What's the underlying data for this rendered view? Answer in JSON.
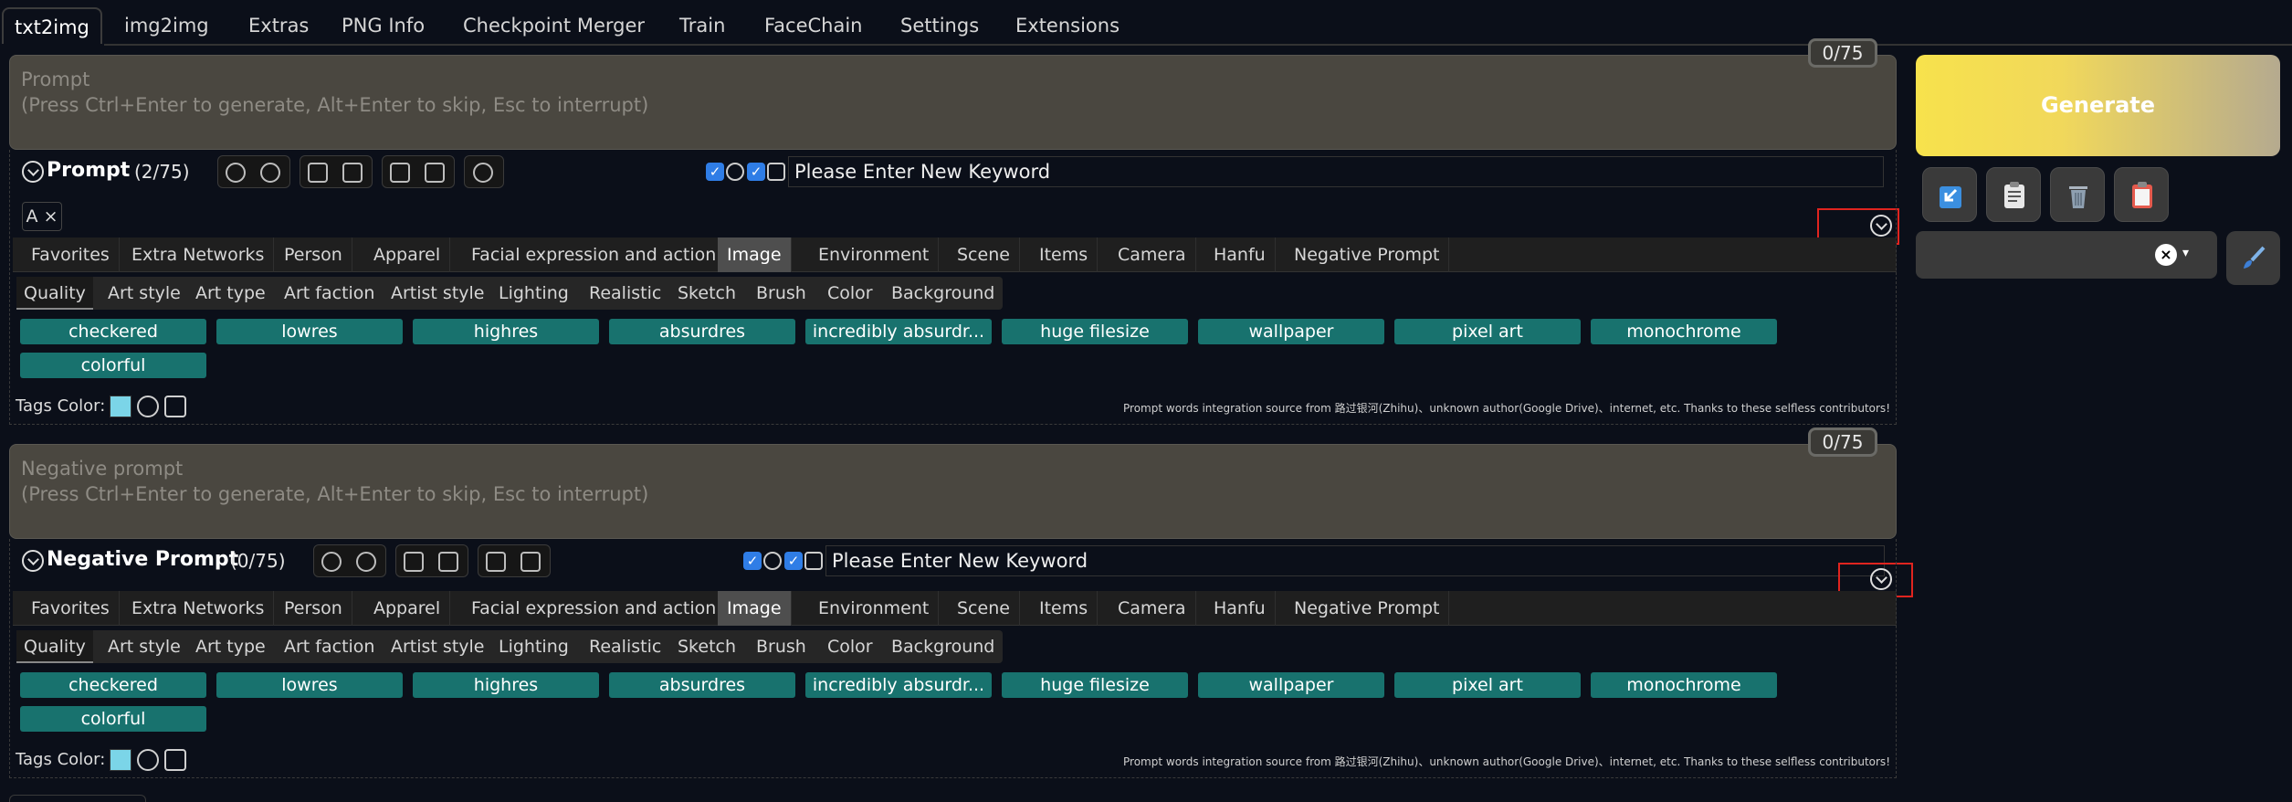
{
  "top_tabs": [
    "txt2img",
    "img2img",
    "Extras",
    "PNG Info",
    "Checkpoint Merger",
    "Train",
    "FaceChain",
    "Settings",
    "Extensions"
  ],
  "prompt": {
    "placeholder_line1": "Prompt",
    "placeholder_line2": "(Press Ctrl+Enter to generate, Alt+Enter to skip, Esc to interrupt)",
    "counter": "0/75"
  },
  "negative_prompt": {
    "placeholder_line1": "Negative prompt",
    "placeholder_line2": "(Press Ctrl+Enter to generate, Alt+Enter to skip, Esc to interrupt)",
    "counter": "0/75"
  },
  "generate": {
    "label": "Generate"
  },
  "prompt_helper": {
    "title": "Prompt",
    "count": "(2/75)",
    "keyword_value": "Please Enter New Keyword",
    "chip_label": "A",
    "chip_close": "×"
  },
  "negative_helper": {
    "title": "Negative Prompt",
    "count": "(0/75)",
    "keyword_value": "Please Enter New Keyword"
  },
  "categories": [
    "Favorites",
    "Extra Networks",
    "Person",
    "Apparel",
    "Facial expression and action",
    "Image",
    "Environment",
    "Scene",
    "Items",
    "Camera",
    "Hanfu",
    "Negative Prompt"
  ],
  "active_category": "Image",
  "subcategories": [
    "Quality",
    "Art style",
    "Art type",
    "Art faction",
    "Artist style",
    "Lighting",
    "Realistic",
    "Sketch",
    "Brush",
    "Color",
    "Background"
  ],
  "active_subcategory": "Quality",
  "tags": [
    "checkered",
    "lowres",
    "highres",
    "absurdres",
    "incredibly absurdr...",
    "huge filesize",
    "wallpaper",
    "pixel art",
    "monochrome",
    "colorful"
  ],
  "tags_color_label": "Tags Color:",
  "source_note": "Prompt words integration source from 路过银河(Zhihu)、unknown author(Google Drive)、internet, etc. Thanks to these selfless contributors!",
  "colors": {
    "tag_bg": "#18726e",
    "generate_start": "#f7e24c",
    "generate_end": "#b5aa8f",
    "checkbox": "#2f7de6",
    "highlight_box": "#e0241f"
  }
}
